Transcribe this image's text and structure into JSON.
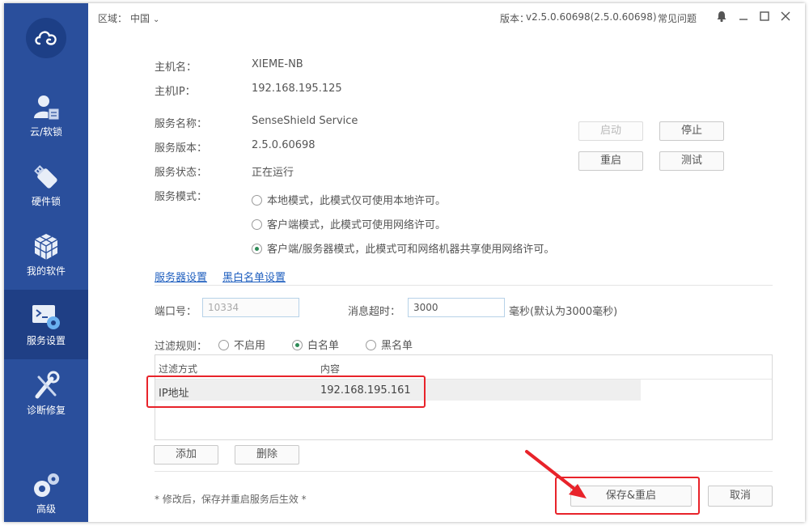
{
  "sidebar": {
    "items": [
      {
        "label": "云/软锁",
        "icon": "cloud-user-icon"
      },
      {
        "label": "硬件锁",
        "icon": "usb-key-icon"
      },
      {
        "label": "我的软件",
        "icon": "cubes-icon"
      },
      {
        "label": "服务设置",
        "icon": "terminal-gear-icon"
      },
      {
        "label": "诊断修复",
        "icon": "wrench-screwdriver-icon"
      },
      {
        "label": "高级",
        "icon": "gears-icon"
      }
    ],
    "active_index": 3
  },
  "titlebar": {
    "region_label": "区域：",
    "region_value": "中国",
    "version_label": "版本：",
    "version_value": "v2.5.0.60698(2.5.0.60698)",
    "faq": "常见问题"
  },
  "host": {
    "name_label": "主机名：",
    "name_value": "XIEME-NB",
    "ip_label": "主机IP：",
    "ip_value": "192.168.195.125"
  },
  "service": {
    "name_label": "服务名称：",
    "name_value": "SenseShield Service",
    "version_label": "服务版本：",
    "version_value": "2.5.0.60698",
    "status_label": "服务状态：",
    "status_value": "正在运行",
    "mode_label": "服务模式：",
    "modes": [
      "本地模式，此模式仅可使用本地许可。",
      "客户端模式，此模式可使用网络许可。",
      "客户端/服务器模式，此模式可和网络机器共享使用网络许可。"
    ],
    "selected_mode": 2,
    "buttons": {
      "start": "启动",
      "stop": "停止",
      "restart": "重启",
      "test": "测试"
    }
  },
  "tabs": [
    "服务器设置",
    "黑白名单设置"
  ],
  "server": {
    "port_label": "端口号：",
    "port_value": "10334",
    "timeout_label": "消息超时：",
    "timeout_value": "3000",
    "timeout_unit": "毫秒(默认为3000毫秒)"
  },
  "filter": {
    "rule_label": "过滤规则：",
    "options": [
      "不启用",
      "白名单",
      "黑名单"
    ],
    "selected": 1,
    "columns": [
      "过滤方式",
      "内容"
    ],
    "rows": [
      {
        "method": "IP地址",
        "content": "192.168.195.161"
      }
    ],
    "add_button": "添加",
    "delete_button": "删除"
  },
  "footer": {
    "note": "* 修改后，保存并重启服务后生效 *",
    "save_button": "保存&重启",
    "cancel_button": "取消"
  },
  "colors": {
    "sidebar": "#2a4f9c",
    "active": "#1f3f85",
    "link": "#1f5fbf",
    "annotation": "#e8232a"
  }
}
